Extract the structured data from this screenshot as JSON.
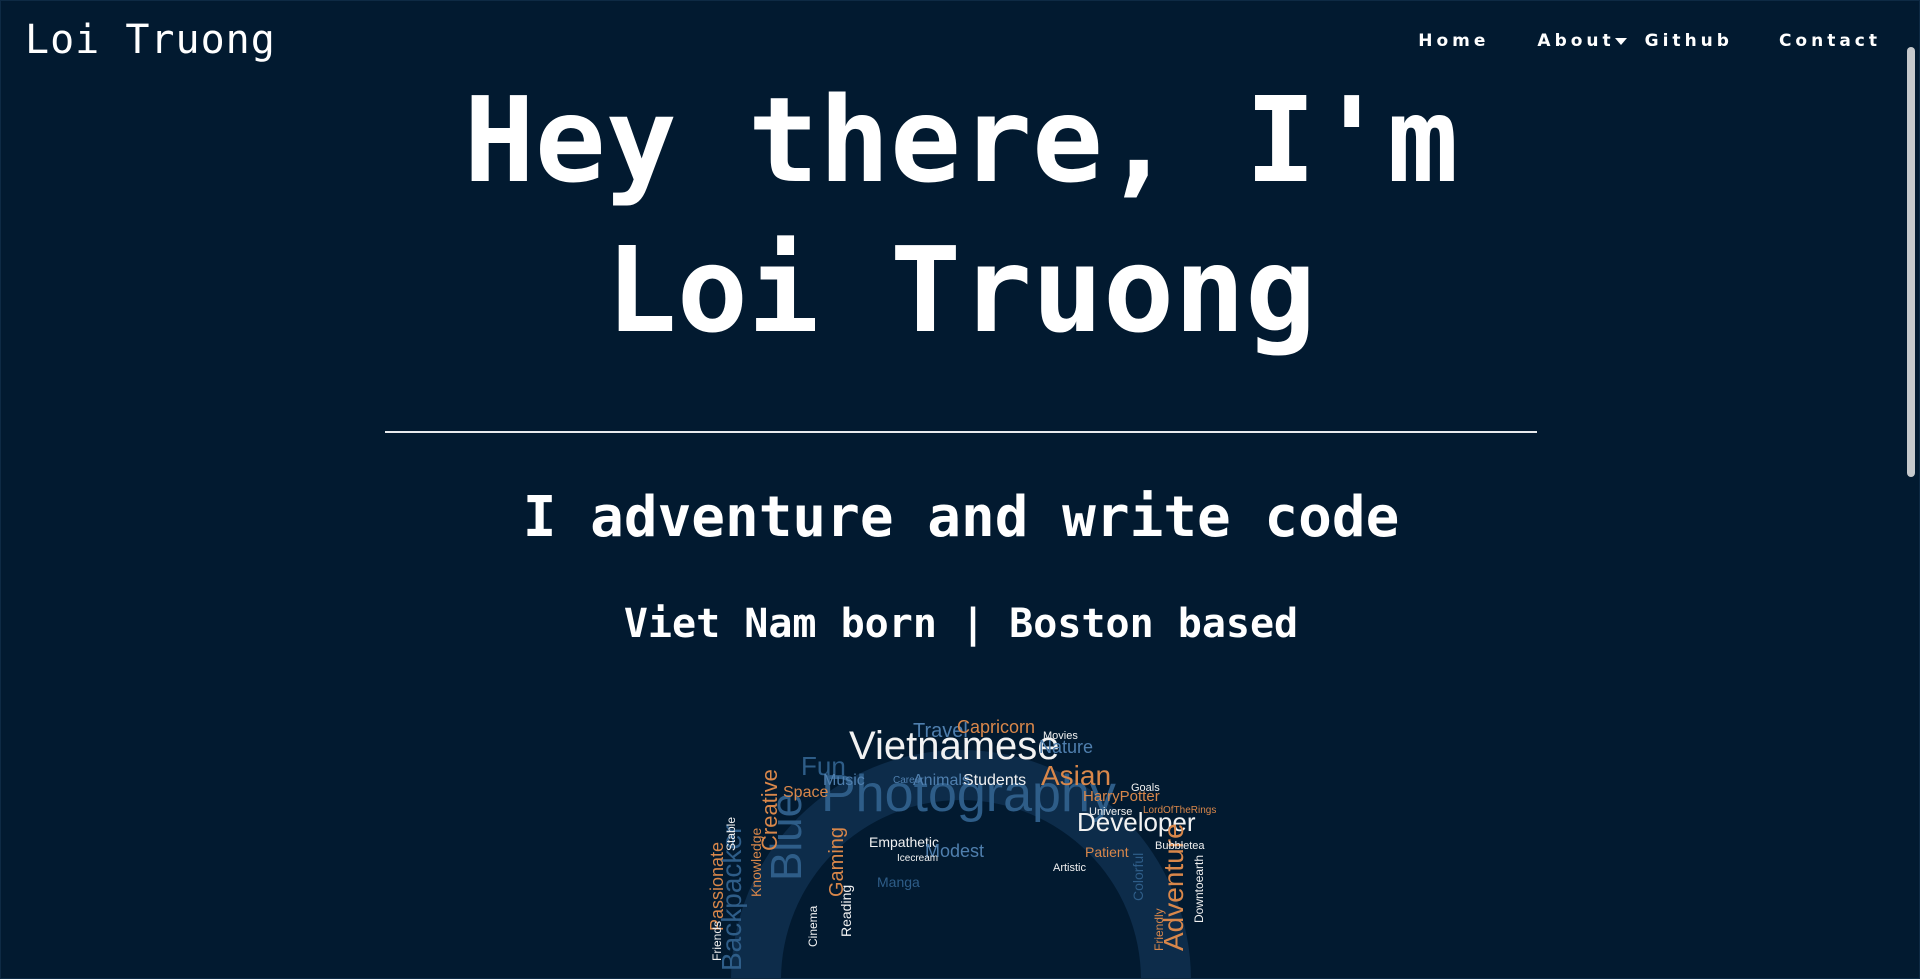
{
  "brand": {
    "name": "Loi Truong"
  },
  "nav": {
    "items": [
      {
        "label": "Home"
      },
      {
        "label": "About"
      },
      {
        "label": "Github"
      },
      {
        "label": "Contact"
      }
    ]
  },
  "hero": {
    "title_line1": "Hey there, I'm",
    "title_line2": "Loi Truong",
    "tagline": "I adventure and write code",
    "location": "Viet Nam born | Boston based"
  },
  "word_cloud": {
    "words": [
      "Vietnamese",
      "Photography",
      "Developer",
      "Asian",
      "Backpacker",
      "Blue",
      "Adventure",
      "Fun",
      "Creative",
      "Travel",
      "Capricorn",
      "Nature",
      "Students",
      "Animals",
      "Music",
      "Space",
      "Passionate",
      "Gaming",
      "Empathetic",
      "Modest",
      "HarryPotter",
      "Universe",
      "Goals",
      "Patient",
      "Colorful",
      "Cinema",
      "Reading",
      "Manga",
      "Stable",
      "Knowledge",
      "Downtoearth",
      "Bubbletea",
      "Friendly",
      "Artistic",
      "Icecream",
      "Friends",
      "Movies",
      "Career",
      "LordOfTheRings"
    ],
    "colors": {
      "blue": "#2e5d88",
      "light_blue": "#4f7fae",
      "orange": "#d9874a",
      "white": "#f2f2f2"
    }
  },
  "colors": {
    "background": "#021a30",
    "text": "#ffffff",
    "divider": "#e8eaed",
    "scrollbar": "#c6c9cc"
  }
}
